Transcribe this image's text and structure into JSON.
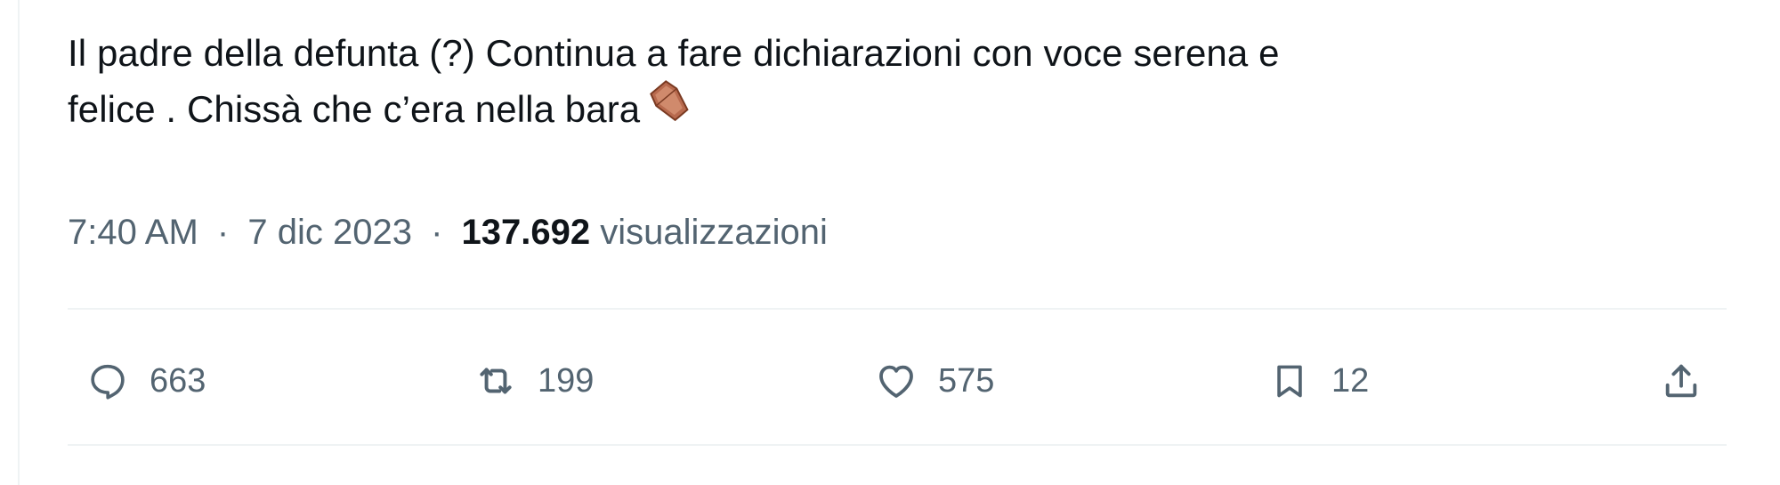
{
  "tweet": {
    "text_line1": "Il padre della defunta (?) Continua a fare dichiarazioni con voce serena  e",
    "text_line2": "felice . Chissà che c’era nella bara",
    "emoji": "coffin-emoji"
  },
  "meta": {
    "time": "7:40 AM",
    "separator": "·",
    "date": "7 dic 2023",
    "views_count": "137.692",
    "views_label": "visualizzazioni"
  },
  "actions": {
    "replies": "663",
    "retweets": "199",
    "likes": "575",
    "bookmarks": "12"
  },
  "icons": {
    "reply": "reply-icon",
    "retweet": "retweet-icon",
    "like": "heart-icon",
    "bookmark": "bookmark-icon",
    "share": "share-icon"
  },
  "colors": {
    "text": "#0f1419",
    "secondary": "#536471",
    "divider": "#eff3f4",
    "coffin": "#b86a4e"
  }
}
